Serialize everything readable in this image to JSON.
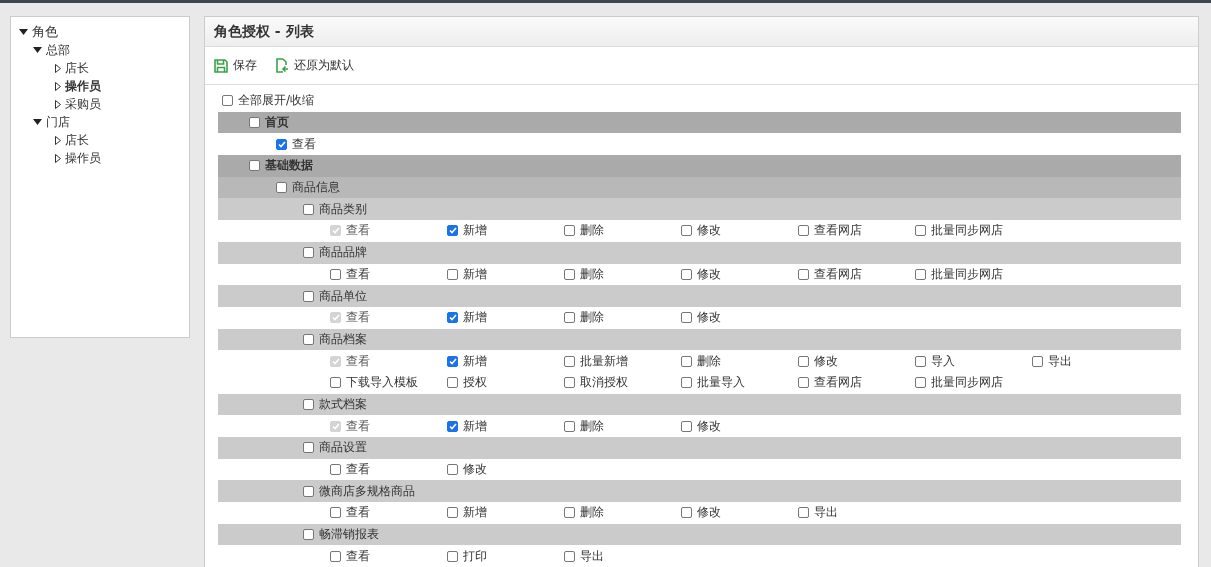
{
  "tree": {
    "label": "角色",
    "expanded": true,
    "children": [
      {
        "label": "总部",
        "expanded": true,
        "children": [
          {
            "label": "店长",
            "selected": false
          },
          {
            "label": "操作员",
            "selected": true
          },
          {
            "label": "采购员",
            "selected": false
          }
        ]
      },
      {
        "label": "门店",
        "expanded": true,
        "children": [
          {
            "label": "店长",
            "selected": false
          },
          {
            "label": "操作员",
            "selected": false
          }
        ]
      }
    ]
  },
  "panel": {
    "title": "角色授权 - 列表",
    "toolbar": [
      {
        "kind": "save",
        "label": "保存"
      },
      {
        "kind": "restore",
        "label": "还原为默认"
      }
    ]
  },
  "expand_all": {
    "label": "全部展开/收缩",
    "checked": false
  },
  "modules": [
    {
      "label": "首页",
      "checked": false,
      "perms": [
        [
          {
            "label": "查看",
            "checked": true,
            "disabled": false
          }
        ]
      ]
    },
    {
      "label": "基础数据",
      "checked": false,
      "children": [
        {
          "label": "商品信息",
          "checked": false,
          "children": [
            {
              "label": "商品类别",
              "checked": false,
              "perms": [
                [
                  {
                    "label": "查看",
                    "checked": true,
                    "disabled": true
                  },
                  {
                    "label": "新增",
                    "checked": true,
                    "disabled": false
                  },
                  {
                    "label": "删除",
                    "checked": false,
                    "disabled": false
                  },
                  {
                    "label": "修改",
                    "checked": false,
                    "disabled": false
                  },
                  {
                    "label": "查看网店",
                    "checked": false,
                    "disabled": false
                  },
                  {
                    "label": "批量同步网店",
                    "checked": false,
                    "disabled": false
                  }
                ]
              ]
            },
            {
              "label": "商品品牌",
              "checked": false,
              "perms": [
                [
                  {
                    "label": "查看",
                    "checked": false,
                    "disabled": false
                  },
                  {
                    "label": "新增",
                    "checked": false,
                    "disabled": false
                  },
                  {
                    "label": "删除",
                    "checked": false,
                    "disabled": false
                  },
                  {
                    "label": "修改",
                    "checked": false,
                    "disabled": false
                  },
                  {
                    "label": "查看网店",
                    "checked": false,
                    "disabled": false
                  },
                  {
                    "label": "批量同步网店",
                    "checked": false,
                    "disabled": false
                  }
                ]
              ]
            },
            {
              "label": "商品单位",
              "checked": false,
              "perms": [
                [
                  {
                    "label": "查看",
                    "checked": true,
                    "disabled": true
                  },
                  {
                    "label": "新增",
                    "checked": true,
                    "disabled": false
                  },
                  {
                    "label": "删除",
                    "checked": false,
                    "disabled": false
                  },
                  {
                    "label": "修改",
                    "checked": false,
                    "disabled": false
                  }
                ]
              ]
            },
            {
              "label": "商品档案",
              "checked": false,
              "perms": [
                [
                  {
                    "label": "查看",
                    "checked": true,
                    "disabled": true
                  },
                  {
                    "label": "新增",
                    "checked": true,
                    "disabled": false
                  },
                  {
                    "label": "批量新增",
                    "checked": false,
                    "disabled": false
                  },
                  {
                    "label": "删除",
                    "checked": false,
                    "disabled": false
                  },
                  {
                    "label": "修改",
                    "checked": false,
                    "disabled": false
                  },
                  {
                    "label": "导入",
                    "checked": false,
                    "disabled": false
                  },
                  {
                    "label": "导出",
                    "checked": false,
                    "disabled": false
                  }
                ],
                [
                  {
                    "label": "下载导入模板",
                    "checked": false,
                    "disabled": false
                  },
                  {
                    "label": "授权",
                    "checked": false,
                    "disabled": false
                  },
                  {
                    "label": "取消授权",
                    "checked": false,
                    "disabled": false
                  },
                  {
                    "label": "批量导入",
                    "checked": false,
                    "disabled": false
                  },
                  {
                    "label": "查看网店",
                    "checked": false,
                    "disabled": false
                  },
                  {
                    "label": "批量同步网店",
                    "checked": false,
                    "disabled": false
                  }
                ]
              ]
            },
            {
              "label": "款式档案",
              "checked": false,
              "perms": [
                [
                  {
                    "label": "查看",
                    "checked": true,
                    "disabled": true
                  },
                  {
                    "label": "新增",
                    "checked": true,
                    "disabled": false
                  },
                  {
                    "label": "删除",
                    "checked": false,
                    "disabled": false
                  },
                  {
                    "label": "修改",
                    "checked": false,
                    "disabled": false
                  }
                ]
              ]
            },
            {
              "label": "商品设置",
              "checked": false,
              "perms": [
                [
                  {
                    "label": "查看",
                    "checked": false,
                    "disabled": false
                  },
                  {
                    "label": "修改",
                    "checked": false,
                    "disabled": false
                  }
                ]
              ]
            },
            {
              "label": "微商店多规格商品",
              "checked": false,
              "perms": [
                [
                  {
                    "label": "查看",
                    "checked": false,
                    "disabled": false
                  },
                  {
                    "label": "新增",
                    "checked": false,
                    "disabled": false
                  },
                  {
                    "label": "删除",
                    "checked": false,
                    "disabled": false
                  },
                  {
                    "label": "修改",
                    "checked": false,
                    "disabled": false
                  },
                  {
                    "label": "导出",
                    "checked": false,
                    "disabled": false
                  }
                ]
              ]
            },
            {
              "label": "畅滞销报表",
              "checked": false,
              "perms": [
                [
                  {
                    "label": "查看",
                    "checked": false,
                    "disabled": false
                  },
                  {
                    "label": "打印",
                    "checked": false,
                    "disabled": false
                  },
                  {
                    "label": "导出",
                    "checked": false,
                    "disabled": false
                  }
                ]
              ]
            }
          ]
        }
      ]
    }
  ]
}
